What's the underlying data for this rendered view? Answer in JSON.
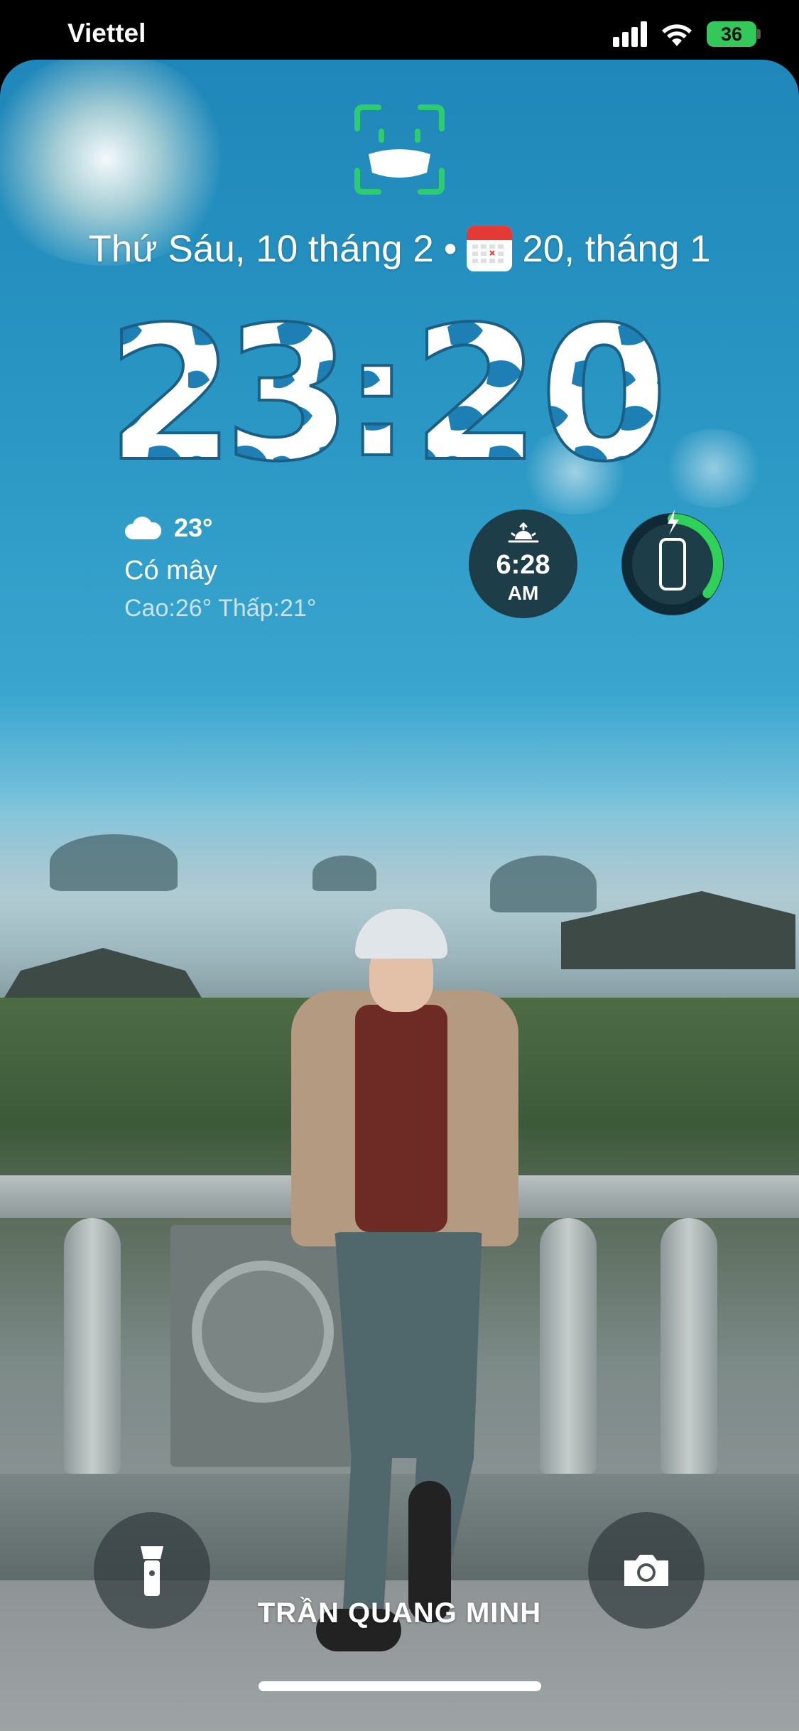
{
  "status_bar": {
    "carrier": "Viettel",
    "battery_level": "36",
    "icons": [
      "cellular-signal-icon",
      "wifi-icon",
      "battery-charging-icon"
    ]
  },
  "lock_screen": {
    "faceid_icon": "faceid-with-mask-icon",
    "date_text": "Thứ Sáu, 10 tháng 2",
    "separator": "•",
    "calendar_icon": "calendar-icon",
    "lunar_date": "20, tháng 1",
    "time": {
      "hour_tens": "2",
      "hour_ones": "3",
      "colon": ":",
      "minute_tens": "2",
      "minute_ones": "0"
    },
    "weather": {
      "icon": "cloud-icon",
      "temperature": "23°",
      "condition": "Có mây",
      "high_low": "Cao:26° Thấp:21°"
    },
    "sunrise_widget": {
      "icon": "sunrise-icon",
      "time": "6:28",
      "ampm": "AM"
    },
    "battery_widget": {
      "icon": "iphone-icon",
      "charging_icon": "lightning-bolt-icon",
      "level_percent": 36,
      "ring_color": "#30d158"
    }
  },
  "bottom": {
    "flashlight_icon": "flashlight-icon",
    "camera_icon": "camera-icon",
    "owner_name": "TRẦN QUANG MINH"
  },
  "colors": {
    "battery_green": "#34c759",
    "faceid_green": "#2ecc71",
    "sunrise_bg": "#1d3d49"
  }
}
